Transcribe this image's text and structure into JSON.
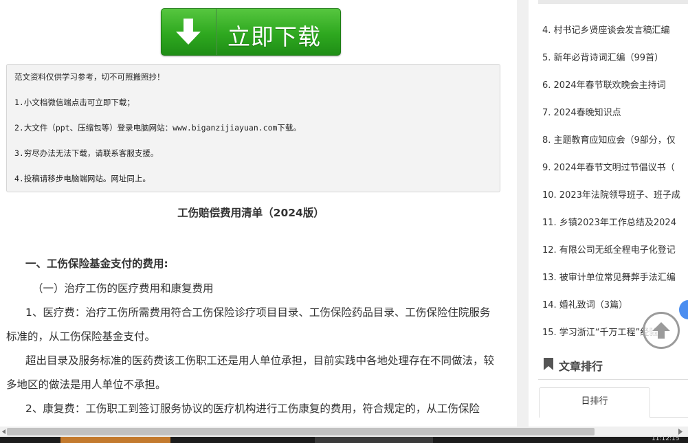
{
  "download": {
    "label": "立即下载"
  },
  "notice": {
    "lines": [
      "范文资料仅供学习参考，切不可照搬照抄！",
      "1.小文档微信端点击可立即下载；",
      "2.大文件（ppt、压缩包等）登录电脑网站：www.biganzijiayuan.com下载。",
      "3.穷尽办法无法下载，请联系客服支援。",
      "4.投稿请移步电脑端网站。网址同上。"
    ]
  },
  "document": {
    "title": "工伤赔偿费用清单（2024版）",
    "section1": "一、工伤保险基金支付的费用:",
    "subsection1": "（一）治疗工伤的医疗费用和康复费用",
    "paragraphs": [
      "1、医疗费：治疗工伤所需费用符合工伤保险诊疗项目目录、工伤保险药品目录、工伤保险住院服务标准的，从工伤保险基金支付。",
      "超出目录及服务标准的医药费该工伤职工还是用人单位承担，目前实践中各地处理存在不同做法，较多地区的做法是用人单位不承担。",
      "2、康复费：工伤职工到签订服务协议的医疗机构进行工伤康复的费用，符合规定的，从工伤保险"
    ]
  },
  "sidebar": {
    "items": [
      "4.  村书记乡贤座谈会发言稿汇编",
      "5.  新年必背诗词汇编（99首）",
      "6.  2024年春节联欢晚会主持词",
      "7.  2024春晚知识点",
      "8.  主题教育应知应会（9部分，仅",
      "9.  2024年春节文明过节倡议书（",
      "10.  2023年法院领导班子、班子成",
      "11.  乡镇2023年工作总结及2024",
      "12.  有限公司无纸全程电子化登记",
      "13.  被审计单位常见舞弊手法汇编",
      "14.  婚礼致词（3篇）",
      "15.  学习浙江“千万工程”经验"
    ],
    "ranking_title": "文章排行",
    "tab_day": "日排行"
  },
  "taskbar": {
    "clock": "11:12:15"
  },
  "colors": {
    "download_green": "#2ea81f",
    "notice_bg": "#f3f3f3",
    "badge_blue": "#4b8ef0"
  }
}
